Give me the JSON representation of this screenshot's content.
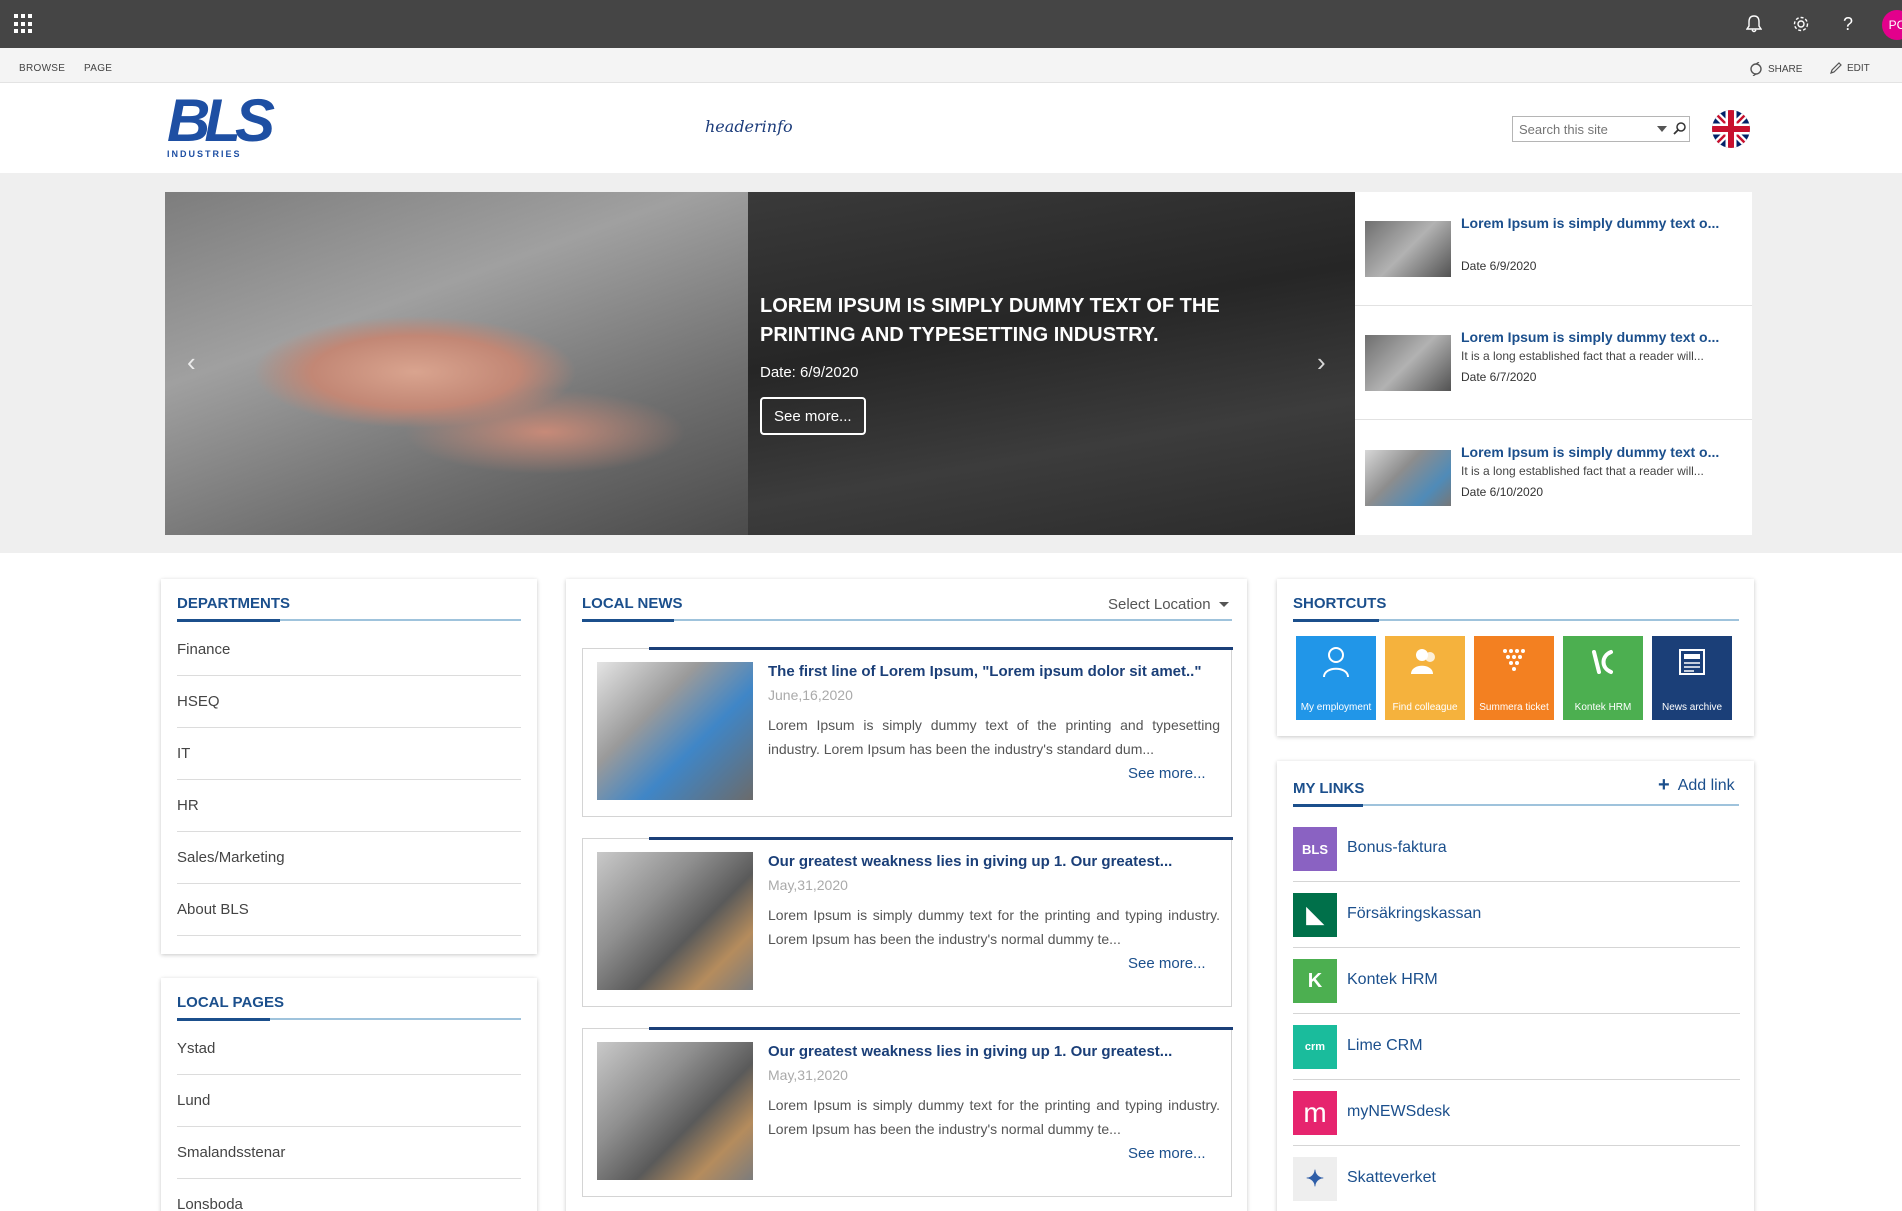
{
  "suitebar": {
    "icons": [
      "waffle-icon",
      "bell-icon",
      "gear-icon",
      "help-icon"
    ],
    "help_glyph": "?",
    "avatar_initials": "PC"
  },
  "ribbon": {
    "tabs": [
      "BROWSE",
      "PAGE"
    ],
    "share_label": "SHARE",
    "edit_label": "EDIT"
  },
  "header": {
    "logo_text": "BLS",
    "logo_subtext": "INDUSTRIES",
    "headerinfo": "headerinfo",
    "search_placeholder": "Search this site",
    "language_icon": "uk-flag-icon"
  },
  "hero": {
    "title": "LOREM IPSUM IS SIMPLY DUMMY TEXT OF THE PRINTING AND TYPESETTING INDUSTRY.",
    "date": "Date: 6/9/2020",
    "button": "See more...",
    "prev_icon": "‹",
    "next_icon": "›",
    "side_news": [
      {
        "title": "Lorem Ipsum is simply dummy text o...",
        "desc": "",
        "date": "Date 6/9/2020"
      },
      {
        "title": "Lorem Ipsum is simply dummy text o...",
        "desc": "It is a long established fact that a reader will...",
        "date": "Date 6/7/2020"
      },
      {
        "title": "Lorem Ipsum is simply dummy text o...",
        "desc": "It is a long established fact that a reader will...",
        "date": "Date 6/10/2020"
      }
    ]
  },
  "departments": {
    "title": "DEPARTMENTS",
    "items": [
      "Finance",
      "HSEQ",
      "IT",
      "HR",
      "Sales/Marketing",
      "About BLS"
    ]
  },
  "local_pages": {
    "title": "LOCAL PAGES",
    "items": [
      "Ystad",
      "Lund",
      "Smalandsstenar",
      "Lonsboda"
    ]
  },
  "local_news": {
    "title": "LOCAL NEWS",
    "select_location": "Select Location",
    "items": [
      {
        "title": "The first line of Lorem Ipsum, \"Lorem ipsum dolor sit amet..\"",
        "date": "June,16,2020",
        "body": "Lorem Ipsum is simply dummy text of the printing and typesetting industry. Lorem Ipsum has been the industry's standard dum...",
        "more": "See more..."
      },
      {
        "title": "Our greatest weakness lies in giving up 1. Our greatest...",
        "date": "May,31,2020",
        "body": "Lorem Ipsum is simply dummy text for the printing and typing industry. Lorem Ipsum has been the industry's normal dummy te...",
        "more": "See more..."
      },
      {
        "title": "Our greatest weakness lies in giving up 1. Our greatest...",
        "date": "May,31,2020",
        "body": "Lorem Ipsum is simply dummy text for the printing and typing industry. Lorem Ipsum has been the industry's normal dummy te...",
        "more": "See more..."
      }
    ]
  },
  "shortcuts": {
    "title": "SHORTCUTS",
    "tiles": [
      {
        "label": "My employment",
        "icon": "person-icon",
        "color": "#2196e8"
      },
      {
        "label": "Find colleague",
        "icon": "people-icon",
        "color": "#f5b23d"
      },
      {
        "label": "Summera ticket",
        "icon": "dots-icon",
        "color": "#f38021"
      },
      {
        "label": "Kontek HRM",
        "icon": "kontek-icon",
        "color": "#4caf50"
      },
      {
        "label": "News archive",
        "icon": "newspaper-icon",
        "color": "#1b3f78"
      }
    ]
  },
  "my_links": {
    "title": "MY LINKS",
    "add_label": "Add link",
    "items": [
      {
        "label": "Bonus-faktura",
        "icon": "bls-bonus-icon",
        "color": "#8a62c2",
        "glyph": "BLS"
      },
      {
        "label": "Försäkringskassan",
        "icon": "fk-icon",
        "color": "#00704a",
        "glyph": "◣"
      },
      {
        "label": "Kontek HRM",
        "icon": "kontek-icon",
        "color": "#4caf50",
        "glyph": "K"
      },
      {
        "label": "Lime CRM",
        "icon": "lime-icon",
        "color": "#1abc9c",
        "glyph": "crm"
      },
      {
        "label": "myNEWSdesk",
        "icon": "mynewsdesk-icon",
        "color": "#e6246e",
        "glyph": "m"
      },
      {
        "label": "Skatteverket",
        "icon": "skatteverket-icon",
        "color": "#eeeeee",
        "glyph": "✦"
      }
    ]
  }
}
